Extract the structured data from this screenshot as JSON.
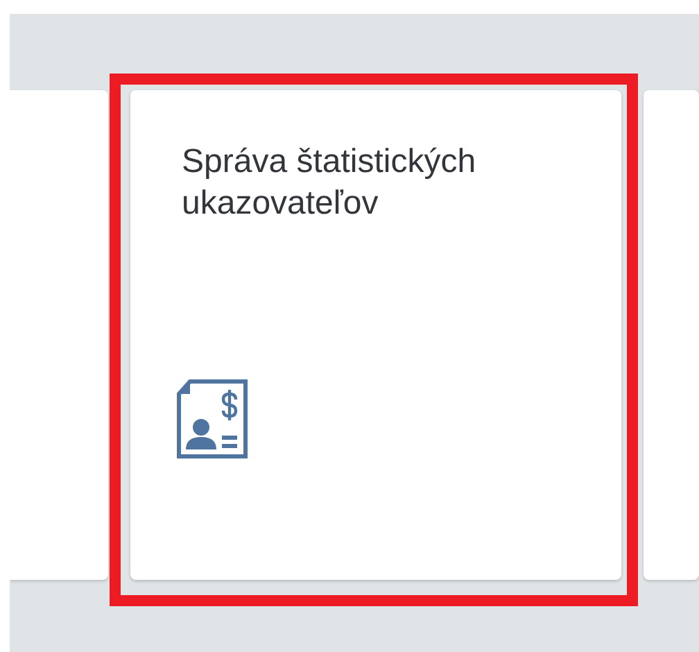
{
  "tile": {
    "title": "Správa štatistických ukazovateľov",
    "highlighted": true
  }
}
